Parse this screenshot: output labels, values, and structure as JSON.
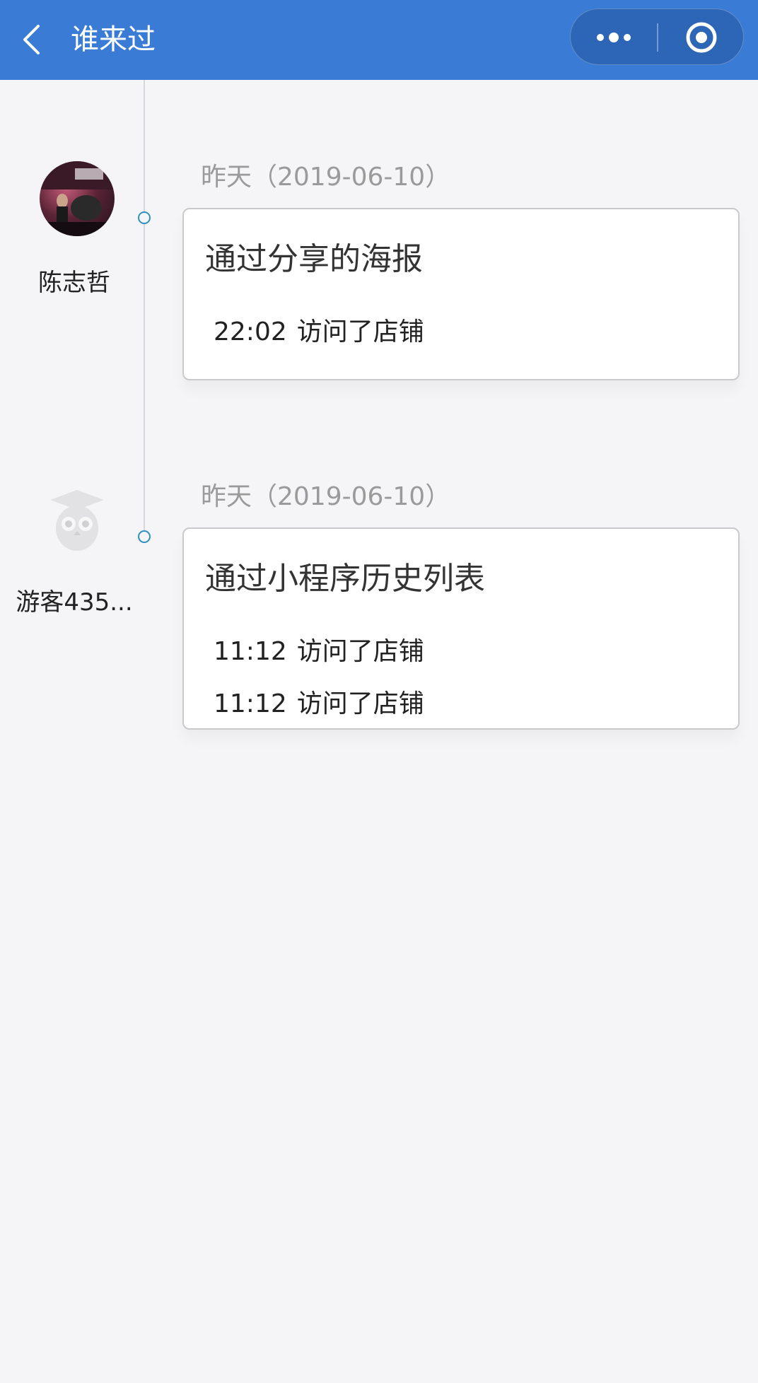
{
  "header": {
    "back_icon": "chevron-left-icon",
    "title": "谁来过",
    "more_icon": "more-dots-icon",
    "close_icon": "target-close-icon",
    "color": "#3a7bd5"
  },
  "visitors": [
    {
      "name": "陈志哲",
      "avatar": "user-photo",
      "date": "昨天（2019-06-10）",
      "source": "通过分享的海报",
      "visits": [
        {
          "time": "22:02",
          "action": "访问了店铺"
        }
      ]
    },
    {
      "name": "游客435...",
      "avatar": "owl-guest-icon",
      "date": "昨天（2019-06-10）",
      "source": "通过小程序历史列表",
      "visits": [
        {
          "time": "11:12",
          "action": "访问了店铺"
        },
        {
          "time": "11:12",
          "action": "访问了店铺"
        }
      ]
    }
  ]
}
